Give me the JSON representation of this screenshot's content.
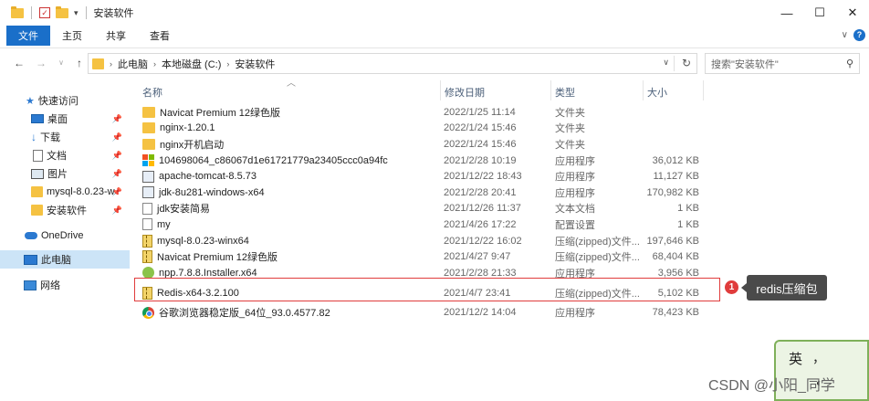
{
  "window": {
    "title": "安装软件",
    "controls": {
      "minimize": "—",
      "maximize": "☐",
      "close": "✕"
    }
  },
  "ribbon": {
    "tabs": [
      "文件",
      "主页",
      "共享",
      "查看"
    ],
    "expand": "∨",
    "help": "?"
  },
  "address": {
    "back": "←",
    "forward": "→",
    "up": "↑",
    "crumbs": [
      "此电脑",
      "本地磁盘 (C:)",
      "安装软件"
    ],
    "dropdown": "∨",
    "refresh": "↻",
    "search_placeholder": "搜索\"安装软件\""
  },
  "nav": {
    "items": [
      {
        "label": "快速访问",
        "icon": "star-icon",
        "pin": ""
      },
      {
        "label": "桌面",
        "icon": "desktop-icon",
        "pin": "📌"
      },
      {
        "label": "下载",
        "icon": "download-icon",
        "pin": "📌"
      },
      {
        "label": "文档",
        "icon": "document-icon",
        "pin": "📌"
      },
      {
        "label": "图片",
        "icon": "pictures-icon",
        "pin": "📌"
      },
      {
        "label": "mysql-8.0.23-w",
        "icon": "folder-icon",
        "pin": "📌"
      },
      {
        "label": "安装软件",
        "icon": "folder-icon",
        "pin": "📌"
      },
      {
        "label": "OneDrive",
        "icon": "cloud-icon",
        "pin": ""
      },
      {
        "label": "此电脑",
        "icon": "pc-icon",
        "pin": ""
      },
      {
        "label": "网络",
        "icon": "network-icon",
        "pin": ""
      }
    ]
  },
  "columns": {
    "name": "名称",
    "date": "修改日期",
    "type": "类型",
    "size": "大小"
  },
  "files": [
    {
      "name": "Navicat Premium 12绿色版",
      "date": "2022/1/25 11:14",
      "type": "文件夹",
      "size": "",
      "icon": "folder-icon"
    },
    {
      "name": "nginx-1.20.1",
      "date": "2022/1/24 15:46",
      "type": "文件夹",
      "size": "",
      "icon": "folder-icon"
    },
    {
      "name": "nginx开机启动",
      "date": "2022/1/24 15:46",
      "type": "文件夹",
      "size": "",
      "icon": "folder-icon"
    },
    {
      "name": "104698064_c86067d1e61721779a23405ccc0a94fc",
      "date": "2021/2/28 10:19",
      "type": "应用程序",
      "size": "36,012 KB",
      "icon": "windows-icon"
    },
    {
      "name": "apache-tomcat-8.5.73",
      "date": "2021/12/22 18:43",
      "type": "应用程序",
      "size": "11,127 KB",
      "icon": "app-icon"
    },
    {
      "name": "jdk-8u281-windows-x64",
      "date": "2021/2/28 20:41",
      "type": "应用程序",
      "size": "170,982 KB",
      "icon": "app-icon"
    },
    {
      "name": "jdk安装简易",
      "date": "2021/12/26 11:37",
      "type": "文本文档",
      "size": "1 KB",
      "icon": "text-file-icon"
    },
    {
      "name": "my",
      "date": "2021/4/26 17:22",
      "type": "配置设置",
      "size": "1 KB",
      "icon": "config-file-icon"
    },
    {
      "name": "mysql-8.0.23-winx64",
      "date": "2021/12/22 16:02",
      "type": "压缩(zipped)文件...",
      "size": "197,646 KB",
      "icon": "zip-icon"
    },
    {
      "name": "Navicat Premium 12绿色版",
      "date": "2021/4/27 9:47",
      "type": "压缩(zipped)文件...",
      "size": "68,404 KB",
      "icon": "zip-icon"
    },
    {
      "name": "npp.7.8.8.Installer.x64",
      "date": "2021/2/28 21:33",
      "type": "应用程序",
      "size": "3,956 KB",
      "icon": "npp-icon"
    },
    {
      "name": "Redis-x64-3.2.100",
      "date": "2021/4/7 23:41",
      "type": "压缩(zipped)文件...",
      "size": "5,102 KB",
      "icon": "zip-icon"
    },
    {
      "name": "谷歌浏览器稳定版_64位_93.0.4577.82",
      "date": "2021/12/2 14:04",
      "type": "应用程序",
      "size": "78,423 KB",
      "icon": "chrome-icon"
    }
  ],
  "annotation": {
    "badge": "1",
    "callout": "redis压缩包"
  },
  "ime": {
    "lang": "英",
    "punct": "，",
    "mode": "◐"
  },
  "watermark": "CSDN @小阳_同学"
}
